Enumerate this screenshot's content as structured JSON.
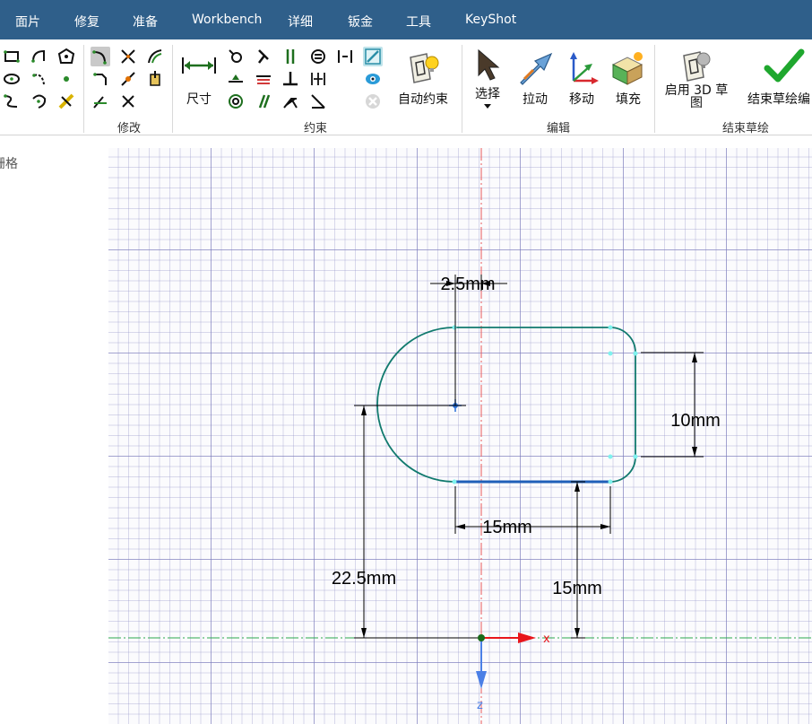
{
  "tabs": [
    "面片",
    "修复",
    "准备",
    "Workbench",
    "详细",
    "钣金",
    "工具",
    "KeyShot"
  ],
  "ribbon": {
    "groups": {
      "modify": "修改",
      "constraint": "约束",
      "edit": "编辑",
      "finish": "结束草绘"
    },
    "buttons": {
      "dimension": "尺寸",
      "auto_constraint": "自动约束",
      "select": "选择",
      "pull": "拉动",
      "move": "移动",
      "fill": "填充",
      "enable_3d": "启用 3D 草图",
      "finish_sketch": "结束草绘编"
    }
  },
  "left_panel": {
    "label": "栅格"
  },
  "sketch": {
    "dimensions": {
      "offset": "2.5mm",
      "height": "10mm",
      "length": "15mm",
      "vertical_left": "22.5mm",
      "vertical_right": "15mm"
    },
    "axis_labels": {
      "x": "x",
      "z": "z"
    }
  },
  "colors": {
    "tabbar": "#2f5f8a",
    "profile": "#117a6e",
    "selected_edge": "#1f5fb8",
    "axis_x": "#e8151b",
    "axis_z": "#4a7fe6",
    "vertical_axis": "#e85a5a",
    "horizontal_axis": "#2ea84e"
  }
}
